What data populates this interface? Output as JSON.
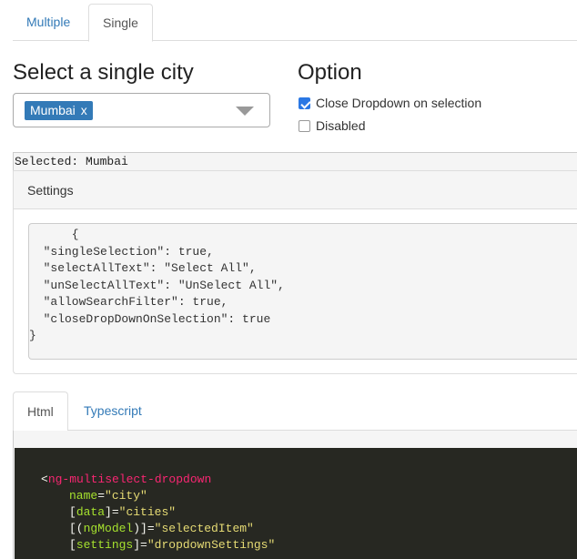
{
  "top_tabs": [
    {
      "label": "Multiple",
      "active": false
    },
    {
      "label": "Single",
      "active": true
    }
  ],
  "left": {
    "heading": "Select a single city",
    "dropdown": {
      "selected_chip": "Mumbai",
      "remove_glyph": "x"
    }
  },
  "right": {
    "heading": "Option",
    "options": [
      {
        "label": "Close Dropdown on selection",
        "checked": true
      },
      {
        "label": "Disabled",
        "checked": false
      }
    ]
  },
  "selected_text": "Selected: Mumbai",
  "settings_panel": {
    "title": "Settings",
    "json_lines": [
      "      {",
      "  \"singleSelection\": true,",
      "  \"selectAllText\": \"Select All\",",
      "  \"unSelectAllText\": \"UnSelect All\",",
      "  \"allowSearchFilter\": true,",
      "  \"closeDropDownOnSelection\": true",
      "}"
    ]
  },
  "code_tabs": [
    {
      "label": "Html",
      "active": true
    },
    {
      "label": "Typescript",
      "active": false
    }
  ],
  "code": {
    "line1": {
      "open": "<",
      "tag": "ng-multiselect-dropdown"
    },
    "line2": {
      "attr": "name",
      "eq": "=",
      "val": "\"city\""
    },
    "line3": {
      "lb": "[",
      "attr": "data",
      "rb": "]",
      "eq": "=",
      "val": "\"cities\""
    },
    "line4": {
      "lb": "[(",
      "attr": "ngModel",
      "rb": ")]",
      "eq": "=",
      "val": "\"selectedItem\""
    },
    "line5": {
      "lb": "[",
      "attr": "settings",
      "rb": "]",
      "eq": "=",
      "val": "\"dropdownSettings\""
    }
  },
  "colors": {
    "link": "#337ab7",
    "chip_bg": "#337ab7",
    "checkbox_checked": "#2b78e4",
    "code_bg": "#272822",
    "code_tag": "#f92672",
    "code_attr": "#a6e22e",
    "code_string": "#e6db74"
  }
}
